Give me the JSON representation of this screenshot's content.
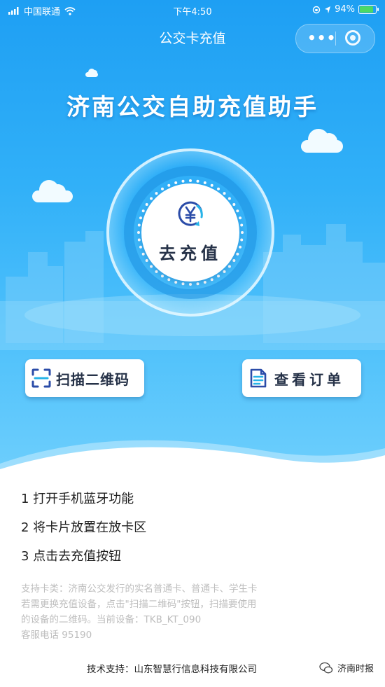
{
  "status_bar": {
    "carrier": "中国联通",
    "time": "下午4:50",
    "battery": "94%",
    "battery_level": 0.94
  },
  "nav": {
    "title": "公交卡充值",
    "menu_icon": "more-dots-icon",
    "close_icon": "close-circle-icon"
  },
  "hero": {
    "title": "济南公交自助充值助手",
    "recharge_label": "去充值",
    "recharge_icon": "yen-refresh-icon"
  },
  "actions": {
    "scan_label": "扫描二维码",
    "scan_icon": "scan-frame-icon",
    "orders_label": "查看订单",
    "orders_icon": "document-icon"
  },
  "steps": [
    "1 打开手机蓝牙功能",
    "2 将卡片放置在放卡区",
    "3 点击去充值按钮"
  ],
  "notes": [
    "支持卡类：济南公交发行的实名普通卡、普通卡、学生卡",
    "若需更换充值设备，点击\"扫描二维码\"按钮，扫描要使用",
    "的设备的二维码。当前设备：TKB_KT_090",
    "客服电话 95190"
  ],
  "footer": {
    "tech_support": "技术支持：山东智慧行信息科技有限公司"
  },
  "watermark": {
    "text": "济南时报",
    "icon": "wechat-icon"
  },
  "colors": {
    "sky_top": "#1e9ff3",
    "sky_bottom": "#6fcffc",
    "button_text": "#263248",
    "icon_blue": "#2b4ca8",
    "icon_accent": "#27b4e8"
  }
}
